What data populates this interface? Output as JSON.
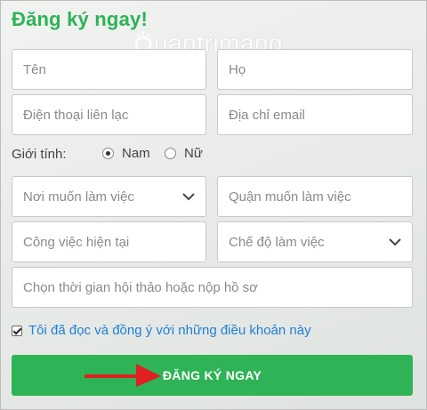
{
  "form": {
    "heading": "Đăng ký ngay!",
    "watermark": "uantrimang",
    "fields": {
      "first_name": {
        "placeholder": "Tên"
      },
      "last_name": {
        "placeholder": "Họ"
      },
      "phone": {
        "placeholder": "Điện thoại liên lạc"
      },
      "email": {
        "placeholder": "Địa chỉ email"
      },
      "work_location": {
        "placeholder": "Nơi muốn làm việc"
      },
      "district": {
        "placeholder": "Quận muốn làm việc"
      },
      "current_job": {
        "placeholder": "Công việc hiện tại"
      },
      "work_mode": {
        "placeholder": "Chế độ làm việc"
      },
      "schedule": {
        "placeholder": "Chọn thời gian hội thảo hoặc nộp hồ sơ"
      }
    },
    "gender": {
      "label": "Giới tính:",
      "options": [
        {
          "label": "Nam",
          "checked": true
        },
        {
          "label": "Nữ",
          "checked": false
        }
      ]
    },
    "agree": {
      "label": "Tôi đã đọc và đồng ý với những điều khoản này",
      "checked": true
    },
    "submit_label": "ĐĂNG KÝ NGAY"
  },
  "colors": {
    "brand_green": "#2eb356",
    "link_blue": "#1f7fd8",
    "annotation_arrow": "#e02020"
  }
}
